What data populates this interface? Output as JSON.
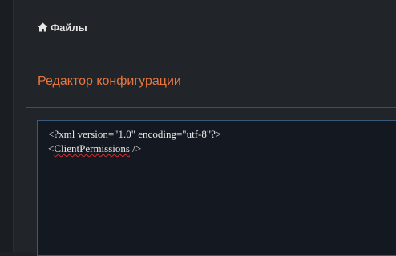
{
  "breadcrumb": {
    "icon": "home-icon",
    "label": "Файлы"
  },
  "section": {
    "title": "Редактор конфигурации"
  },
  "editor": {
    "line1": "<?xml version=\"1.0\" encoding=\"utf-8\"?>",
    "line2_open": "<",
    "line2_tag": "ClientPermissions",
    "line2_close": " />"
  },
  "colors": {
    "accent": "#e8773f",
    "background": "#212429",
    "editor_background": "#141820",
    "editor_border": "#3a5a7c"
  }
}
